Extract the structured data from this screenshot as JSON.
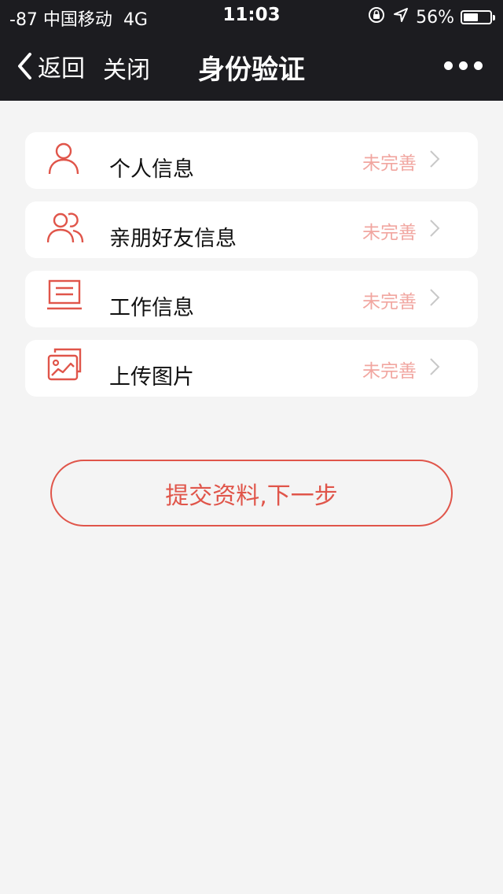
{
  "status_bar": {
    "carrier": "-87 中国移动",
    "network": "4G",
    "time": "11:03",
    "battery_percent": "56%",
    "battery_level": 0.56
  },
  "nav": {
    "back_label": "返回",
    "close_label": "关闭",
    "title": "身份验证"
  },
  "items": [
    {
      "label": "个人信息",
      "status": "未完善",
      "icon": "person-icon"
    },
    {
      "label": "亲朋好友信息",
      "status": "未完善",
      "icon": "contacts-icon"
    },
    {
      "label": "工作信息",
      "status": "未完善",
      "icon": "laptop-icon"
    },
    {
      "label": "上传图片",
      "status": "未完善",
      "icon": "image-gallery-icon"
    }
  ],
  "submit_label": "提交资料,下一步",
  "colors": {
    "accent": "#e0554a",
    "status_text": "#f1a6a0",
    "bar_background": "#1c1c20",
    "page_background": "#f4f4f4"
  }
}
